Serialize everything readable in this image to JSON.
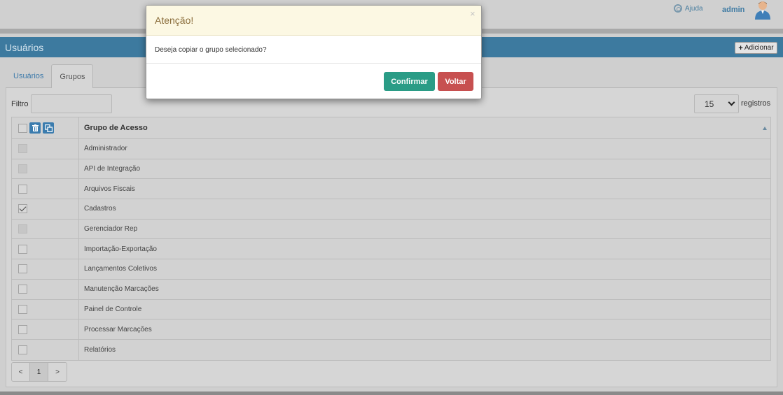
{
  "header": {
    "help_label": "Ajuda",
    "user_name": "admin"
  },
  "titlebar": {
    "title": "Usuários",
    "add_label": "Adicionar"
  },
  "tabs": [
    {
      "label": "Usuários",
      "active": false
    },
    {
      "label": "Grupos",
      "active": true
    }
  ],
  "filter": {
    "label": "Filtro",
    "value": ""
  },
  "per_page": {
    "value": "15",
    "label": "registros"
  },
  "table": {
    "column_header": "Grupo de Acesso",
    "rows": [
      {
        "name": "Administrador",
        "state": "disabled"
      },
      {
        "name": "API de Integração",
        "state": "disabled"
      },
      {
        "name": "Arquivos Fiscais",
        "state": "unchecked"
      },
      {
        "name": "Cadastros",
        "state": "checked"
      },
      {
        "name": "Gerenciador Rep",
        "state": "disabled"
      },
      {
        "name": "Importação-Exportação",
        "state": "unchecked"
      },
      {
        "name": "Lançamentos Coletivos",
        "state": "unchecked"
      },
      {
        "name": "Manutenção Marcações",
        "state": "unchecked"
      },
      {
        "name": "Painel de Controle",
        "state": "unchecked"
      },
      {
        "name": "Processar Marcações",
        "state": "unchecked"
      },
      {
        "name": "Relatórios",
        "state": "unchecked"
      }
    ]
  },
  "pagination": {
    "prev": "<",
    "current": "1",
    "next": ">"
  },
  "modal": {
    "title": "Atenção!",
    "close": "×",
    "message": "Deseja copiar o grupo selecionado?",
    "confirm_label": "Confirmar",
    "back_label": "Voltar"
  },
  "colors": {
    "titlebar": "#3d7a9f",
    "confirm": "#2a9c86",
    "back": "#c75050",
    "warning_bg": "#fcf8e3"
  }
}
